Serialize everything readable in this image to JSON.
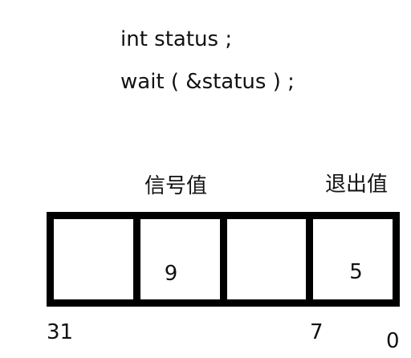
{
  "code": {
    "line1": "int status ;",
    "line2": "wait ( &status ) ;"
  },
  "labels": {
    "signal": "信号值",
    "exit": "退出值"
  },
  "register": {
    "cells": [
      "",
      "9",
      "",
      "5"
    ]
  },
  "bits": {
    "high": "31",
    "mid": "7",
    "low": "0"
  }
}
